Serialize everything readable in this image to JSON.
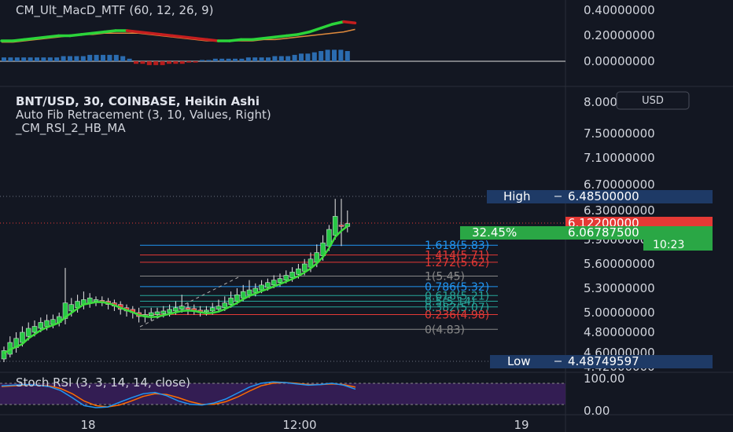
{
  "macd_pane": {
    "title": "CM_Ult_MacD_MTF (60, 12, 26, 9)",
    "axis_labels": [
      "0.40000000",
      "0.20000000",
      "0.00000000"
    ]
  },
  "main_pane": {
    "title": "BNT/USD, 30, COINBASE, Heikin Ashi",
    "subtitle1": "Auto Fib Retracement (3, 10, Values, Right)",
    "subtitle2": "_CM_RSI_2_HB_MA",
    "currency_badge": "USD",
    "axis_labels": [
      "8.00000000",
      "7.50000000",
      "7.10000000",
      "6.70000000",
      "6.30000000",
      "5.90000000",
      "5.60000000",
      "5.30000000",
      "5.00000000",
      "4.80000000",
      "4.60000000",
      "4.42000000"
    ],
    "high_label": "High",
    "high_value": "6.48500000",
    "low_label": "Low",
    "low_value": "4.48749597",
    "last_price": "6.12200000",
    "pct_change": "32.45%",
    "ma_value": "6.06787500",
    "countdown": "10:23",
    "fib_labels": [
      "1.618(5.83)",
      "1.414(5.71)",
      "1.272(5.62)",
      "1(5.45)",
      "0.786(5.32)",
      "0.618(5.21)",
      "0.5(5.14)",
      "0.382(5.07)",
      "0.236(4.98)",
      "0(4.83)"
    ]
  },
  "rsi_pane": {
    "title": "Stoch RSI (3, 3, 14, 14, close)",
    "axis_labels": [
      "100.00",
      "0.00"
    ]
  },
  "time_axis": {
    "labels": [
      "18",
      "12:00",
      "19"
    ]
  },
  "colors": {
    "background": "#131722",
    "up": "#26c644",
    "down": "#e63a3a",
    "high_low_label": "#1e3a66",
    "last_price": "#e53935",
    "pct_change": "#2aa745",
    "rsi_band": "#3a1f5c",
    "fib_1618": "#2196f3",
    "fib_1414": "#e53935",
    "fib_1272": "#e53935",
    "fib_1": "#888888",
    "fib_0786": "#2196f3",
    "fib_0618": "#26a69a",
    "fib_05": "#26a69a",
    "fib_0382": "#26a69a",
    "fib_0236": "#e53935",
    "fib_0": "#888888"
  },
  "chart_data": {
    "type": "candlestick",
    "price_range": [
      4.42,
      8.0
    ],
    "high": 6.485,
    "low": 4.48749597,
    "last_price": 6.122,
    "ma_value": 6.067875,
    "fib_levels": [
      {
        "ratio": 1.618,
        "price": 5.83
      },
      {
        "ratio": 1.414,
        "price": 5.71
      },
      {
        "ratio": 1.272,
        "price": 5.62
      },
      {
        "ratio": 1.0,
        "price": 5.45
      },
      {
        "ratio": 0.786,
        "price": 5.32
      },
      {
        "ratio": 0.618,
        "price": 5.21
      },
      {
        "ratio": 0.5,
        "price": 5.14
      },
      {
        "ratio": 0.382,
        "price": 5.07
      },
      {
        "ratio": 0.236,
        "price": 4.98
      },
      {
        "ratio": 0.0,
        "price": 4.83
      }
    ],
    "candles": [
      [
        4.52,
        4.62,
        4.48,
        4.66
      ],
      [
        4.58,
        4.7,
        4.54,
        4.76
      ],
      [
        4.65,
        4.74,
        4.6,
        4.8
      ],
      [
        4.7,
        4.8,
        4.66,
        4.86
      ],
      [
        4.76,
        4.84,
        4.72,
        4.9
      ],
      [
        4.8,
        4.86,
        4.76,
        4.92
      ],
      [
        4.84,
        4.9,
        4.8,
        4.95
      ],
      [
        4.86,
        4.92,
        4.82,
        4.98
      ],
      [
        4.88,
        4.93,
        4.84,
        4.98
      ],
      [
        4.9,
        4.96,
        4.86,
        5.0
      ],
      [
        4.94,
        5.12,
        4.88,
        5.55
      ],
      [
        5.02,
        5.1,
        4.96,
        5.18
      ],
      [
        5.06,
        5.14,
        5.0,
        5.22
      ],
      [
        5.1,
        5.16,
        5.04,
        5.26
      ],
      [
        5.12,
        5.18,
        5.06,
        5.24
      ],
      [
        5.14,
        5.16,
        5.08,
        5.2
      ],
      [
        5.15,
        5.14,
        5.08,
        5.2
      ],
      [
        5.14,
        5.1,
        5.04,
        5.18
      ],
      [
        5.12,
        5.08,
        5.02,
        5.16
      ],
      [
        5.1,
        5.04,
        4.98,
        5.14
      ],
      [
        5.06,
        5.02,
        4.96,
        5.1
      ],
      [
        5.04,
        5.0,
        4.94,
        5.08
      ],
      [
        5.0,
        4.96,
        4.9,
        5.06
      ],
      [
        4.96,
        4.98,
        4.9,
        5.04
      ],
      [
        4.97,
        5.0,
        4.92,
        5.06
      ],
      [
        4.98,
        5.01,
        4.94,
        5.06
      ],
      [
        4.99,
        5.02,
        4.95,
        5.08
      ],
      [
        5.0,
        5.04,
        4.96,
        5.1
      ],
      [
        5.02,
        5.06,
        4.98,
        5.14
      ],
      [
        5.04,
        5.08,
        5.0,
        5.22
      ],
      [
        5.06,
        5.04,
        4.98,
        5.12
      ],
      [
        5.05,
        5.02,
        4.98,
        5.1
      ],
      [
        5.03,
        5.0,
        4.96,
        5.08
      ],
      [
        5.01,
        5.03,
        4.97,
        5.08
      ],
      [
        5.02,
        5.06,
        4.98,
        5.12
      ],
      [
        5.04,
        5.08,
        5.0,
        5.16
      ],
      [
        5.06,
        5.12,
        5.02,
        5.2
      ],
      [
        5.1,
        5.18,
        5.06,
        5.26
      ],
      [
        5.14,
        5.22,
        5.1,
        5.3
      ],
      [
        5.18,
        5.26,
        5.14,
        5.34
      ],
      [
        5.22,
        5.28,
        5.18,
        5.4
      ],
      [
        5.25,
        5.3,
        5.2,
        5.36
      ],
      [
        5.28,
        5.34,
        5.24,
        5.4
      ],
      [
        5.31,
        5.37,
        5.27,
        5.42
      ],
      [
        5.34,
        5.4,
        5.3,
        5.46
      ],
      [
        5.37,
        5.42,
        5.32,
        5.48
      ],
      [
        5.4,
        5.46,
        5.36,
        5.52
      ],
      [
        5.43,
        5.5,
        5.38,
        5.56
      ],
      [
        5.47,
        5.54,
        5.42,
        5.6
      ],
      [
        5.51,
        5.6,
        5.46,
        5.66
      ],
      [
        5.56,
        5.66,
        5.5,
        5.74
      ],
      [
        5.62,
        5.74,
        5.56,
        5.84
      ],
      [
        5.7,
        5.86,
        5.64,
        5.96
      ],
      [
        5.82,
        6.04,
        5.76,
        6.1
      ],
      [
        5.96,
        6.22,
        5.9,
        6.48
      ],
      [
        6.1,
        6.08,
        5.82,
        6.48
      ],
      [
        6.08,
        6.12,
        6.0,
        6.3
      ]
    ],
    "macd": {
      "histogram": [
        0.03,
        0.03,
        0.03,
        0.03,
        0.03,
        0.03,
        0.03,
        0.03,
        0.03,
        0.04,
        0.04,
        0.04,
        0.04,
        0.05,
        0.05,
        0.05,
        0.05,
        0.05,
        0.04,
        0.02,
        -0.02,
        -0.02,
        -0.03,
        -0.03,
        -0.03,
        -0.02,
        -0.02,
        -0.02,
        -0.01,
        -0.01,
        0.01,
        0.01,
        0.02,
        0.02,
        0.02,
        0.02,
        0.02,
        0.03,
        0.03,
        0.03,
        0.03,
        0.04,
        0.04,
        0.04,
        0.05,
        0.06,
        0.06,
        0.07,
        0.08,
        0.09,
        0.09,
        0.09,
        0.08
      ],
      "macd_line": [
        0.16,
        0.16,
        0.17,
        0.18,
        0.19,
        0.2,
        0.2,
        0.21,
        0.22,
        0.23,
        0.24,
        0.24,
        0.23,
        0.22,
        0.21,
        0.2,
        0.19,
        0.18,
        0.17,
        0.16,
        0.16,
        0.17,
        0.17,
        0.18,
        0.19,
        0.2,
        0.21,
        0.23,
        0.26,
        0.29,
        0.31,
        0.3
      ],
      "signal_line": [
        0.15,
        0.15,
        0.16,
        0.17,
        0.18,
        0.19,
        0.2,
        0.21,
        0.21,
        0.22,
        0.22,
        0.22,
        0.22,
        0.21,
        0.2,
        0.19,
        0.18,
        0.17,
        0.16,
        0.16,
        0.16,
        0.16,
        0.16,
        0.17,
        0.17,
        0.18,
        0.19,
        0.2,
        0.21,
        0.22,
        0.23,
        0.25
      ]
    },
    "stoch_rsi": {
      "range": [
        0,
        100
      ],
      "k": [
        78,
        80,
        82,
        80,
        76,
        64,
        42,
        18,
        12,
        14,
        28,
        42,
        54,
        58,
        48,
        32,
        22,
        20,
        26,
        38,
        56,
        74,
        86,
        90,
        88,
        84,
        80,
        82,
        86,
        80,
        68
      ],
      "d": [
        76,
        78,
        80,
        80,
        78,
        70,
        54,
        32,
        18,
        14,
        20,
        32,
        46,
        54,
        52,
        42,
        30,
        22,
        22,
        30,
        44,
        62,
        78,
        86,
        88,
        86,
        82,
        82,
        84,
        82,
        74
      ]
    }
  }
}
